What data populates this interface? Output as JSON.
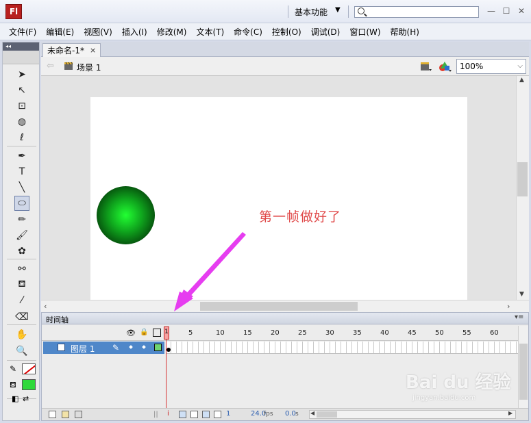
{
  "app": {
    "logo": "Fl",
    "workspace": "基本功能",
    "search_placeholder": ""
  },
  "menu": [
    "文件(F)",
    "编辑(E)",
    "视图(V)",
    "插入(I)",
    "修改(M)",
    "文本(T)",
    "命令(C)",
    "控制(O)",
    "调试(D)",
    "窗口(W)",
    "帮助(H)"
  ],
  "toolbox": {
    "collapse_glyph": "◂◂",
    "tools": [
      {
        "name": "selection-tool-icon",
        "glyph": "➤"
      },
      {
        "name": "subselection-tool-icon",
        "glyph": "↖"
      },
      {
        "name": "free-transform-tool-icon",
        "glyph": "⊡"
      },
      {
        "name": "3d-rotation-tool-icon",
        "glyph": "◍"
      },
      {
        "name": "lasso-tool-icon",
        "glyph": "ℓ"
      },
      {
        "name": "pen-tool-icon",
        "glyph": "✒"
      },
      {
        "name": "text-tool-icon",
        "glyph": "T"
      },
      {
        "name": "line-tool-icon",
        "glyph": "╲"
      },
      {
        "name": "oval-tool-icon",
        "glyph": "⬭"
      },
      {
        "name": "pencil-tool-icon",
        "glyph": "✏"
      },
      {
        "name": "brush-tool-icon",
        "glyph": "🖌"
      },
      {
        "name": "deco-tool-icon",
        "glyph": "✿"
      },
      {
        "name": "bone-tool-icon",
        "glyph": "⚯"
      },
      {
        "name": "paint-bucket-tool-icon",
        "glyph": "⛾"
      },
      {
        "name": "eyedropper-tool-icon",
        "glyph": "⁄"
      },
      {
        "name": "eraser-tool-icon",
        "glyph": "⌫"
      },
      {
        "name": "hand-tool-icon",
        "glyph": "✋"
      },
      {
        "name": "zoom-tool-icon",
        "glyph": "🔍"
      }
    ],
    "selected_tool": "oval-tool-icon",
    "stroke_color": "none",
    "fill_color": "#2fd93a"
  },
  "document": {
    "tab_title": "未命名-1*",
    "close_glyph": "×"
  },
  "scene": {
    "back_glyph": "⇦",
    "label": "场景 1"
  },
  "zoom": {
    "value": "100%",
    "arrow": "⌵"
  },
  "stage": {
    "annotation": "第一帧做好了"
  },
  "timeline": {
    "tab": "时间轴",
    "menu_glyph": "▾≡",
    "ticks": [
      "1",
      "5",
      "10",
      "15",
      "20",
      "25",
      "30",
      "35",
      "40",
      "45",
      "50",
      "55",
      "60"
    ],
    "layer": {
      "name": "图层 1",
      "pencil": "✎"
    },
    "current_frame_label": "1",
    "frame_readout": "1",
    "fps": "24.0",
    "fps_unit": "fps",
    "time": "0.0",
    "time_unit": "s"
  },
  "watermark": {
    "brand": "Bai du 经验",
    "sub": "jingyan.baidu.com"
  }
}
